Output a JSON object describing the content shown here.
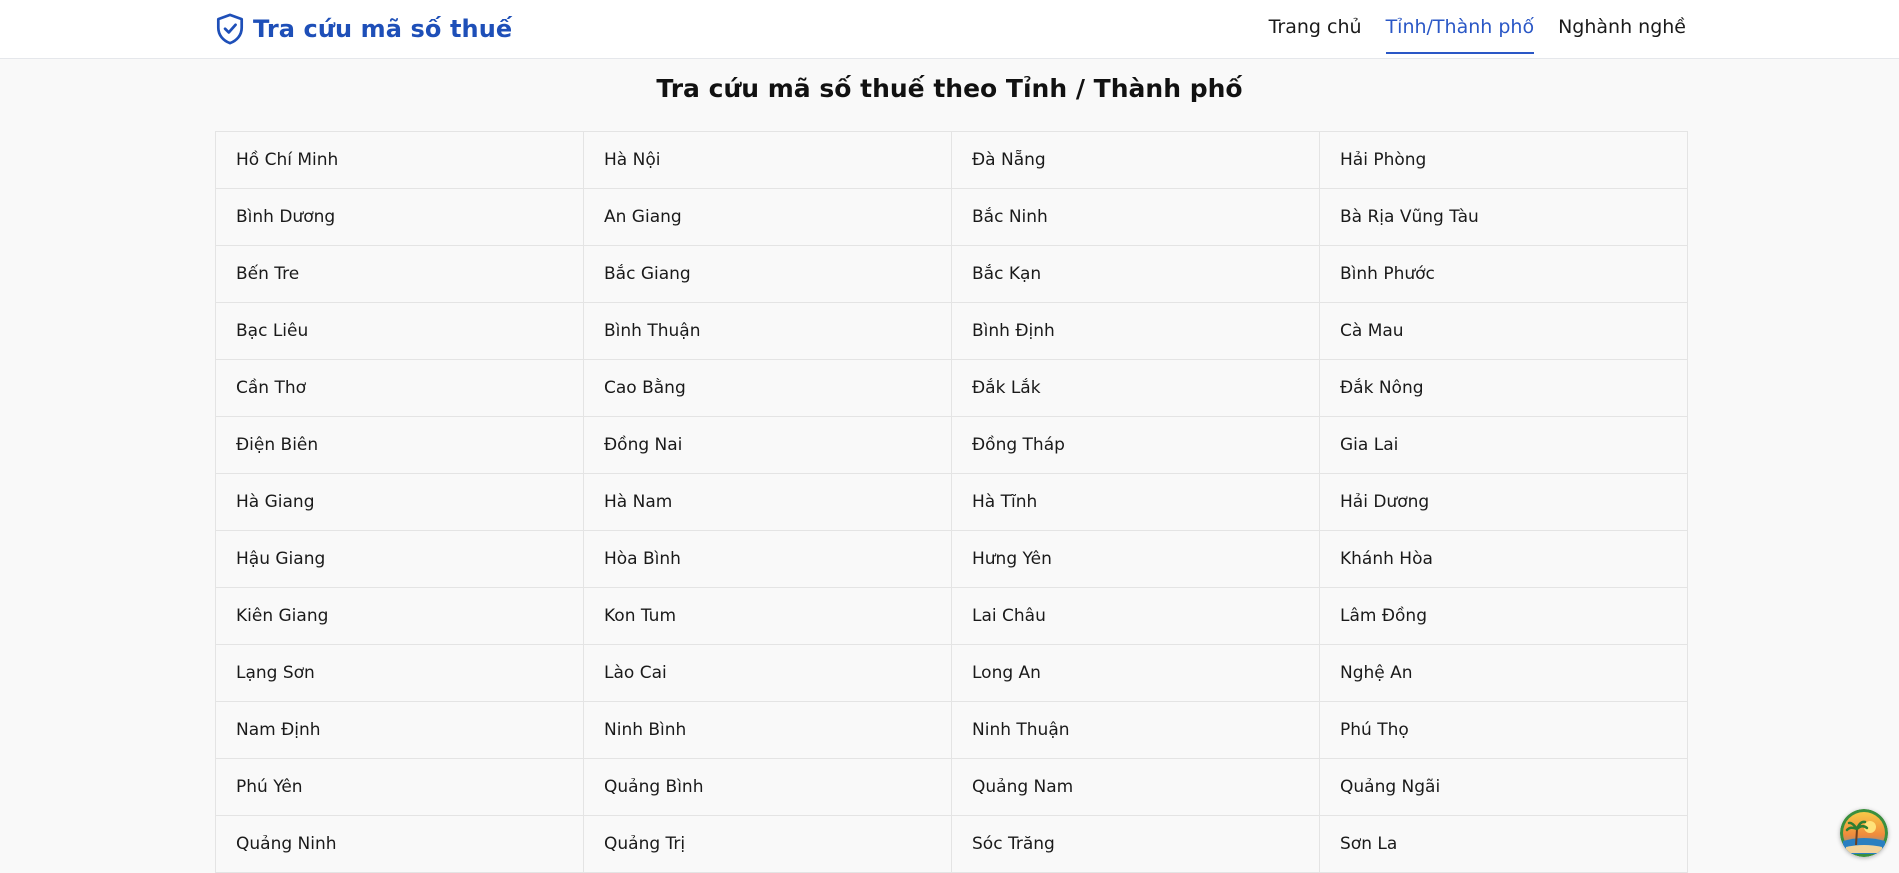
{
  "header": {
    "brand_title": "Tra cứu mã số thuế",
    "brand_icon": "shield-check-icon",
    "nav": [
      {
        "label": "Trang chủ",
        "active": false
      },
      {
        "label": "Tỉnh/Thành phố",
        "active": true
      },
      {
        "label": "Nghành nghề",
        "active": false
      }
    ]
  },
  "page": {
    "title": "Tra cứu mã số thuế theo Tỉnh / Thành phố"
  },
  "provinces": [
    "Hồ Chí Minh",
    "Hà Nội",
    "Đà Nẵng",
    "Hải Phòng",
    "Bình Dương",
    "An Giang",
    "Bắc Ninh",
    "Bà Rịa Vũng Tàu",
    "Bến Tre",
    "Bắc Giang",
    "Bắc Kạn",
    "Bình Phước",
    "Bạc Liêu",
    "Bình Thuận",
    "Bình Định",
    "Cà Mau",
    "Cần Thơ",
    "Cao Bằng",
    "Đắk Lắk",
    "Đắk Nông",
    "Điện Biên",
    "Đồng Nai",
    "Đồng Tháp",
    "Gia Lai",
    "Hà Giang",
    "Hà Nam",
    "Hà Tĩnh",
    "Hải Dương",
    "Hậu Giang",
    "Hòa Bình",
    "Hưng Yên",
    "Khánh Hòa",
    "Kiên Giang",
    "Kon Tum",
    "Lai Châu",
    "Lâm Đồng",
    "Lạng Sơn",
    "Lào Cai",
    "Long An",
    "Nghệ An",
    "Nam Định",
    "Ninh Bình",
    "Ninh Thuận",
    "Phú Thọ",
    "Phú Yên",
    "Quảng Bình",
    "Quảng Nam",
    "Quảng Ngãi",
    "Quảng Ninh",
    "Quảng Trị",
    "Sóc Trăng",
    "Sơn La"
  ],
  "floating_button": {
    "icon": "beach-avatar-icon"
  },
  "colors": {
    "brand": "#1e4fb8",
    "nav_active": "#2a57c6",
    "background": "#f9f9f9",
    "border": "#e4e4e4"
  }
}
